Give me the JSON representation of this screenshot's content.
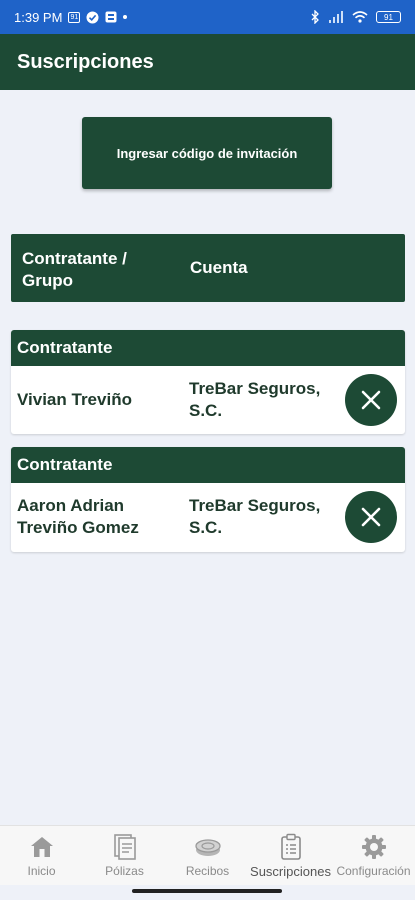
{
  "status_bar": {
    "time": "1:39 PM",
    "sim_badge": "91",
    "battery": "91"
  },
  "app_bar": {
    "title": "Suscripciones"
  },
  "invite_button": {
    "label": "Ingresar código de invitación"
  },
  "table_header": {
    "group_label": "Contratante / Grupo",
    "account_label": "Cuenta"
  },
  "subscriptions": [
    {
      "type": "Contratante",
      "holder": "Vivian Treviño",
      "account": "TreBar Seguros, S.C."
    },
    {
      "type": "Contratante",
      "holder": "Aaron Adrian Treviño Gomez",
      "account": "TreBar Seguros, S.C."
    }
  ],
  "bottom_nav": {
    "items": [
      {
        "label": "Inicio",
        "icon": "home-icon"
      },
      {
        "label": "Pólizas",
        "icon": "policy-document-icon"
      },
      {
        "label": "Recibos",
        "icon": "coins-icon"
      },
      {
        "label": "Suscripciones",
        "icon": "clipboard-icon",
        "active": true
      },
      {
        "label": "Configuración",
        "icon": "gear-icon"
      }
    ]
  },
  "colors": {
    "primary": "#1d4a35",
    "status_bar": "#1f63c8",
    "background": "#eef1f8"
  }
}
